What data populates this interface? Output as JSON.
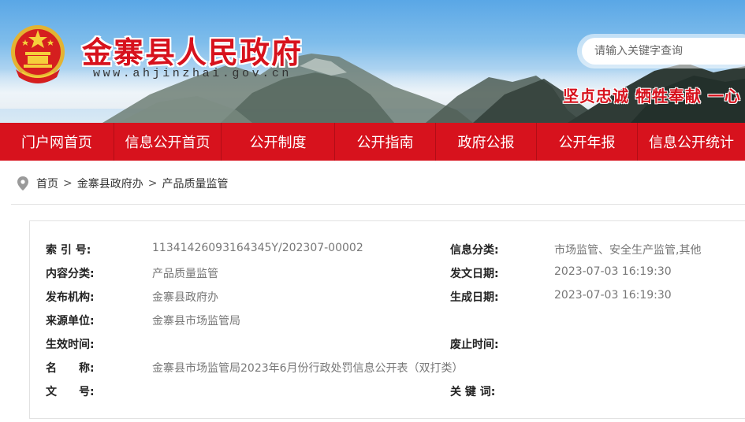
{
  "header": {
    "site_title": "金寨县人民政府",
    "site_url": "www.ahjinzhai.gov.cn",
    "search_placeholder": "请输入关键字查询",
    "slogan": "坚贞忠诚  牺牲奉献  一心"
  },
  "nav": {
    "items": [
      {
        "label": "门户网首页"
      },
      {
        "label": "信息公开首页"
      },
      {
        "label": "公开制度"
      },
      {
        "label": "公开指南"
      },
      {
        "label": "政府公报"
      },
      {
        "label": "公开年报"
      },
      {
        "label": "信息公开统计"
      }
    ]
  },
  "breadcrumb": {
    "items": [
      "首页",
      "金寨县政府办",
      "产品质量监管"
    ],
    "separator": ">"
  },
  "info": {
    "index_label": "索 引 号:",
    "index_value": "11341426093164345Y/202307-00002",
    "category_label": "信息分类:",
    "category_value": "市场监管、安全生产监管,其他",
    "content_label": "内容分类:",
    "content_value": "产品质量监管",
    "issue_date_label": "发文日期:",
    "issue_date_value": "2023-07-03 16:19:30",
    "publisher_label": "发布机构:",
    "publisher_value": "金寨县政府办",
    "created_label": "生成日期:",
    "created_value": "2023-07-03 16:19:30",
    "source_label": "来源单位:",
    "source_value": "金寨县市场监管局",
    "effective_label": "生效时间:",
    "effective_value": "",
    "abolish_label": "废止时间:",
    "abolish_value": "",
    "name_label": "名　　称:",
    "name_value": "金寨县市场监管局2023年6月份行政处罚信息公开表（双打类）",
    "doc_no_label": "文　　号:",
    "doc_no_value": "",
    "keywords_label": "关 键 词:",
    "keywords_value": ""
  },
  "colors": {
    "brand_red": "#d7121d",
    "nav_divider": "#b20d16"
  },
  "icons": [
    "national-emblem-icon",
    "location-pin-icon"
  ]
}
